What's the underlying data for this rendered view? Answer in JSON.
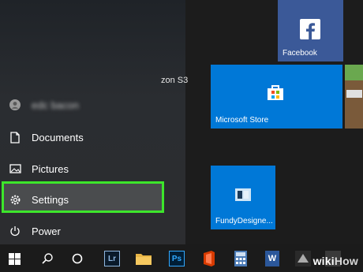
{
  "start_menu": {
    "user": {
      "name": "edc bacon"
    },
    "items": [
      {
        "label": "Documents",
        "icon": "document-icon"
      },
      {
        "label": "Pictures",
        "icon": "pictures-icon"
      },
      {
        "label": "Settings",
        "icon": "gear-icon",
        "highlighted": true
      },
      {
        "label": "Power",
        "icon": "power-icon"
      }
    ]
  },
  "partial_text": "zon S3",
  "tiles": [
    {
      "label": "Facebook",
      "color": "#3b5998"
    },
    {
      "label": "Microsoft Store",
      "color": "#0078d7"
    },
    {
      "label": "FundyDesigne...",
      "color": "#0078d7"
    }
  ],
  "taskbar": {
    "items": [
      "start-button",
      "search-icon",
      "cortana-icon",
      "lightroom-icon",
      "file-explorer-icon",
      "photoshop-icon",
      "office-icon",
      "calculator-icon",
      "word-icon",
      "app-icon",
      "app-icon"
    ],
    "lightroom_label": "Lr",
    "photoshop_label": "Ps",
    "word_label": "W"
  },
  "watermark": {
    "part1": "wiki",
    "part2": "How"
  },
  "colors": {
    "highlight": "#3de62b",
    "tile_blue": "#0078d7",
    "facebook_blue": "#3b5998"
  }
}
